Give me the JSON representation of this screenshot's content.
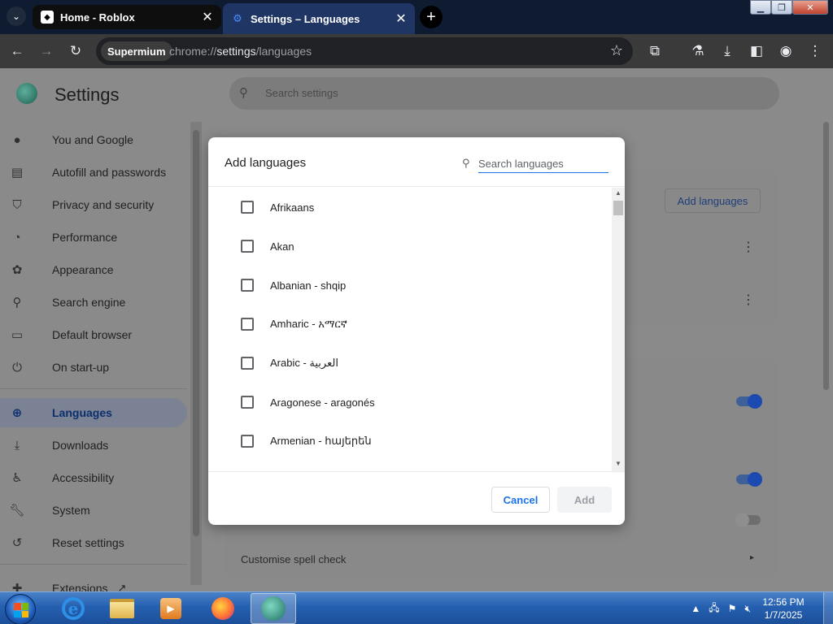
{
  "browser": {
    "tabs": [
      {
        "title": "Home - Roblox",
        "icon": "roblox-icon",
        "active": false
      },
      {
        "title": "Settings – Languages",
        "icon": "settings-gear-icon",
        "active": true
      }
    ],
    "omnibox": {
      "chip": "Supermium",
      "url_prefix": "chrome://",
      "url_host": "settings",
      "url_path": "/languages"
    }
  },
  "settings": {
    "title": "Settings",
    "search_placeholder": "Search settings",
    "nav": [
      {
        "label": "You and Google",
        "icon": "person-icon"
      },
      {
        "label": "Autofill and passwords",
        "icon": "clipboard-icon"
      },
      {
        "label": "Privacy and security",
        "icon": "shield-icon"
      },
      {
        "label": "Performance",
        "icon": "speedometer-icon"
      },
      {
        "label": "Appearance",
        "icon": "palette-icon"
      },
      {
        "label": "Search engine",
        "icon": "search-icon"
      },
      {
        "label": "Default browser",
        "icon": "browser-window-icon"
      },
      {
        "label": "On start-up",
        "icon": "power-icon"
      },
      {
        "label": "Languages",
        "icon": "globe-icon",
        "selected": true
      },
      {
        "label": "Downloads",
        "icon": "download-icon"
      },
      {
        "label": "Accessibility",
        "icon": "accessibility-icon"
      },
      {
        "label": "System",
        "icon": "wrench-icon"
      },
      {
        "label": "Reset settings",
        "icon": "reset-icon"
      },
      {
        "label": "Extensions",
        "icon": "puzzle-icon"
      }
    ],
    "background_add_languages": "Add languages",
    "customise_spell_check": "Customise spell check"
  },
  "dialog": {
    "title": "Add languages",
    "search_placeholder": "Search languages",
    "languages": [
      "Afrikaans",
      "Akan",
      "Albanian - shqip",
      "Amharic - አማርኛ",
      "Arabic - العربية",
      "Aragonese - aragonés",
      "Armenian - հայերեն"
    ],
    "cancel_label": "Cancel",
    "add_label": "Add"
  },
  "taskbar": {
    "time": "12:56 PM",
    "date": "1/7/2025",
    "apps": [
      "internet-explorer-icon",
      "file-explorer-icon",
      "media-player-icon",
      "firefox-icon",
      "supermium-icon"
    ]
  }
}
